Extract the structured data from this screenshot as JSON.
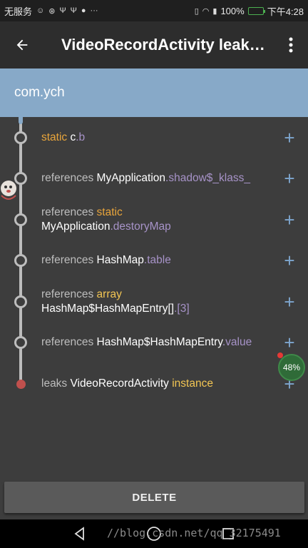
{
  "status_bar": {
    "carrier": "无服务",
    "battery": "100%",
    "battery_level": 1.0,
    "time": "下午4:28"
  },
  "toolbar": {
    "title": "VideoRecordActivity leak…"
  },
  "header": {
    "package": "com.ych"
  },
  "trace": [
    {
      "parts": [
        {
          "t": "static ",
          "s": "kw"
        },
        {
          "t": "c",
          "s": "cls"
        },
        {
          "t": ".b",
          "s": "fld"
        }
      ]
    },
    {
      "parts": [
        {
          "t": "references ",
          "s": "ref"
        },
        {
          "t": "MyApplication",
          "s": "cls"
        },
        {
          "t": ".shadow$_klass_",
          "s": "fld"
        }
      ]
    },
    {
      "parts": [
        {
          "t": "references ",
          "s": "ref"
        },
        {
          "t": "static",
          "s": "kw"
        },
        {
          "t": "\n",
          "s": "br"
        },
        {
          "t": "MyApplication",
          "s": "cls"
        },
        {
          "t": ".destoryMap",
          "s": "fld"
        }
      ]
    },
    {
      "parts": [
        {
          "t": "references ",
          "s": "ref"
        },
        {
          "t": "HashMap",
          "s": "cls"
        },
        {
          "t": ".table",
          "s": "fld"
        }
      ]
    },
    {
      "parts": [
        {
          "t": "references ",
          "s": "ref"
        },
        {
          "t": "array",
          "s": "inst"
        },
        {
          "t": "\n",
          "s": "br"
        },
        {
          "t": "HashMap$HashMapEntry[]",
          "s": "cls"
        },
        {
          "t": ".[3]",
          "s": "fld"
        }
      ]
    },
    {
      "parts": [
        {
          "t": "references ",
          "s": "ref"
        },
        {
          "t": "HashMap$HashMapEntry",
          "s": "cls"
        },
        {
          "t": ".value",
          "s": "fld"
        }
      ]
    },
    {
      "parts": [
        {
          "t": "leaks ",
          "s": "ref"
        },
        {
          "t": "VideoRecordActivity",
          "s": "cls"
        },
        {
          "t": " instance",
          "s": "inst"
        }
      ]
    }
  ],
  "plus_label": "+",
  "progress_badge": "48%",
  "delete_label": "DELETE",
  "watermark": "//blog.csdn.net/qq_32175491",
  "colors": {
    "toolbar": "#2d2d2d",
    "header": "#87a9c8",
    "keyword": "#e9a53b",
    "field": "#a793c8",
    "instance": "#f2c553",
    "plus": "#7ea6cf",
    "leak_node": "#c0504d"
  },
  "icons": {
    "back": "arrow-left-icon",
    "menu": "more-vert-icon",
    "nav_back": "triangle-back-icon",
    "nav_home": "circle-home-icon"
  }
}
